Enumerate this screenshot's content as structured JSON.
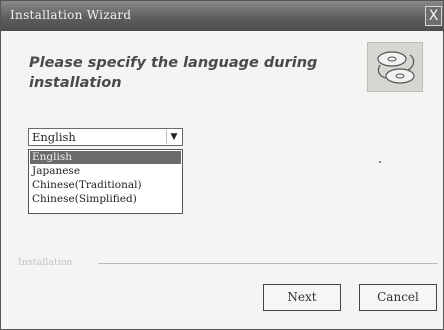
{
  "window": {
    "title": "Installation  Wizard",
    "close_label": "X"
  },
  "header": {
    "heading": "Please specify the language during installation",
    "logo_icon": "cd-install-icon"
  },
  "language": {
    "selected_value": "English",
    "options": [
      {
        "label": "English",
        "selected": true
      },
      {
        "label": "Japanese",
        "selected": false
      },
      {
        "label": "Chinese(Traditional)",
        "selected": false
      },
      {
        "label": "Chinese(Simplified)",
        "selected": false
      }
    ]
  },
  "footer": {
    "group_label": "Installation",
    "next_label": "Next",
    "cancel_label": "Cancel"
  },
  "colors": {
    "titlebar": "#5e5e5e",
    "selection": "#6b6b6b",
    "dialog_bg": "#f4f4f2"
  }
}
